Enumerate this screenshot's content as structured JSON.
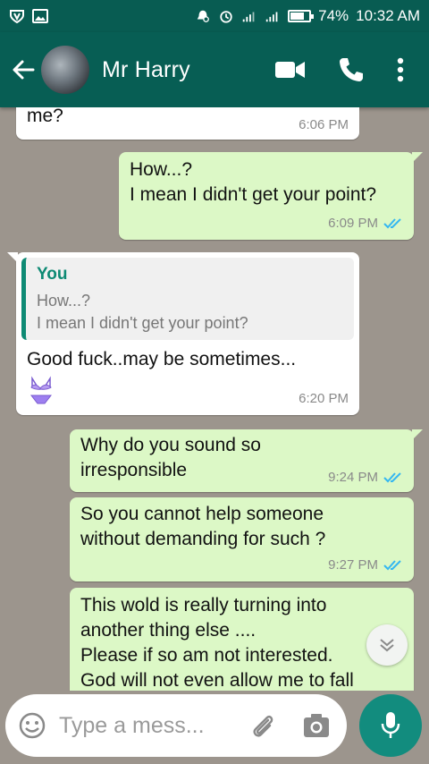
{
  "status_bar": {
    "battery": "74%",
    "battery_level": 0.74,
    "time": "10:32 AM"
  },
  "header": {
    "contact_name": "Mr Harry",
    "icons": [
      "back-arrow-icon",
      "video-call-icon",
      "phone-icon",
      "more-vert-icon"
    ]
  },
  "messages": [
    {
      "direction": "incoming",
      "text": "me?",
      "time": "6:06 PM"
    },
    {
      "direction": "outgoing",
      "text": "How...?\nI mean I didn't get your point?",
      "time": "6:09 PM",
      "status": "read"
    },
    {
      "direction": "incoming",
      "reply": {
        "author": "You",
        "text": "How...?\nI mean I didn't get your point?"
      },
      "text": "Good fuck..may be sometimes...",
      "emoji": "bikini",
      "time": "6:20 PM"
    },
    {
      "direction": "outgoing",
      "text": "Why do you sound so\nirresponsible",
      "time": "9:24 PM",
      "status": "read"
    },
    {
      "direction": "outgoing",
      "text": "So you cannot help someone\nwithout demanding for such ?",
      "time": "9:27 PM",
      "status": "read"
    },
    {
      "direction": "outgoing",
      "text": "This wold is really turning into\nanother thing else ....\nPlease if so am not interested.\nGod will not even allow me to fall",
      "time": ""
    }
  ],
  "composer": {
    "placeholder": "Type a mess..."
  },
  "colors": {
    "header": "#075e54",
    "status_bar": "#085c52",
    "outgoing_bubble": "#dcf8c6",
    "incoming_bubble": "#ffffff",
    "read_ticks": "#34b7f1",
    "reply_accent": "#0e8a74",
    "mic_button": "#128c7e"
  }
}
